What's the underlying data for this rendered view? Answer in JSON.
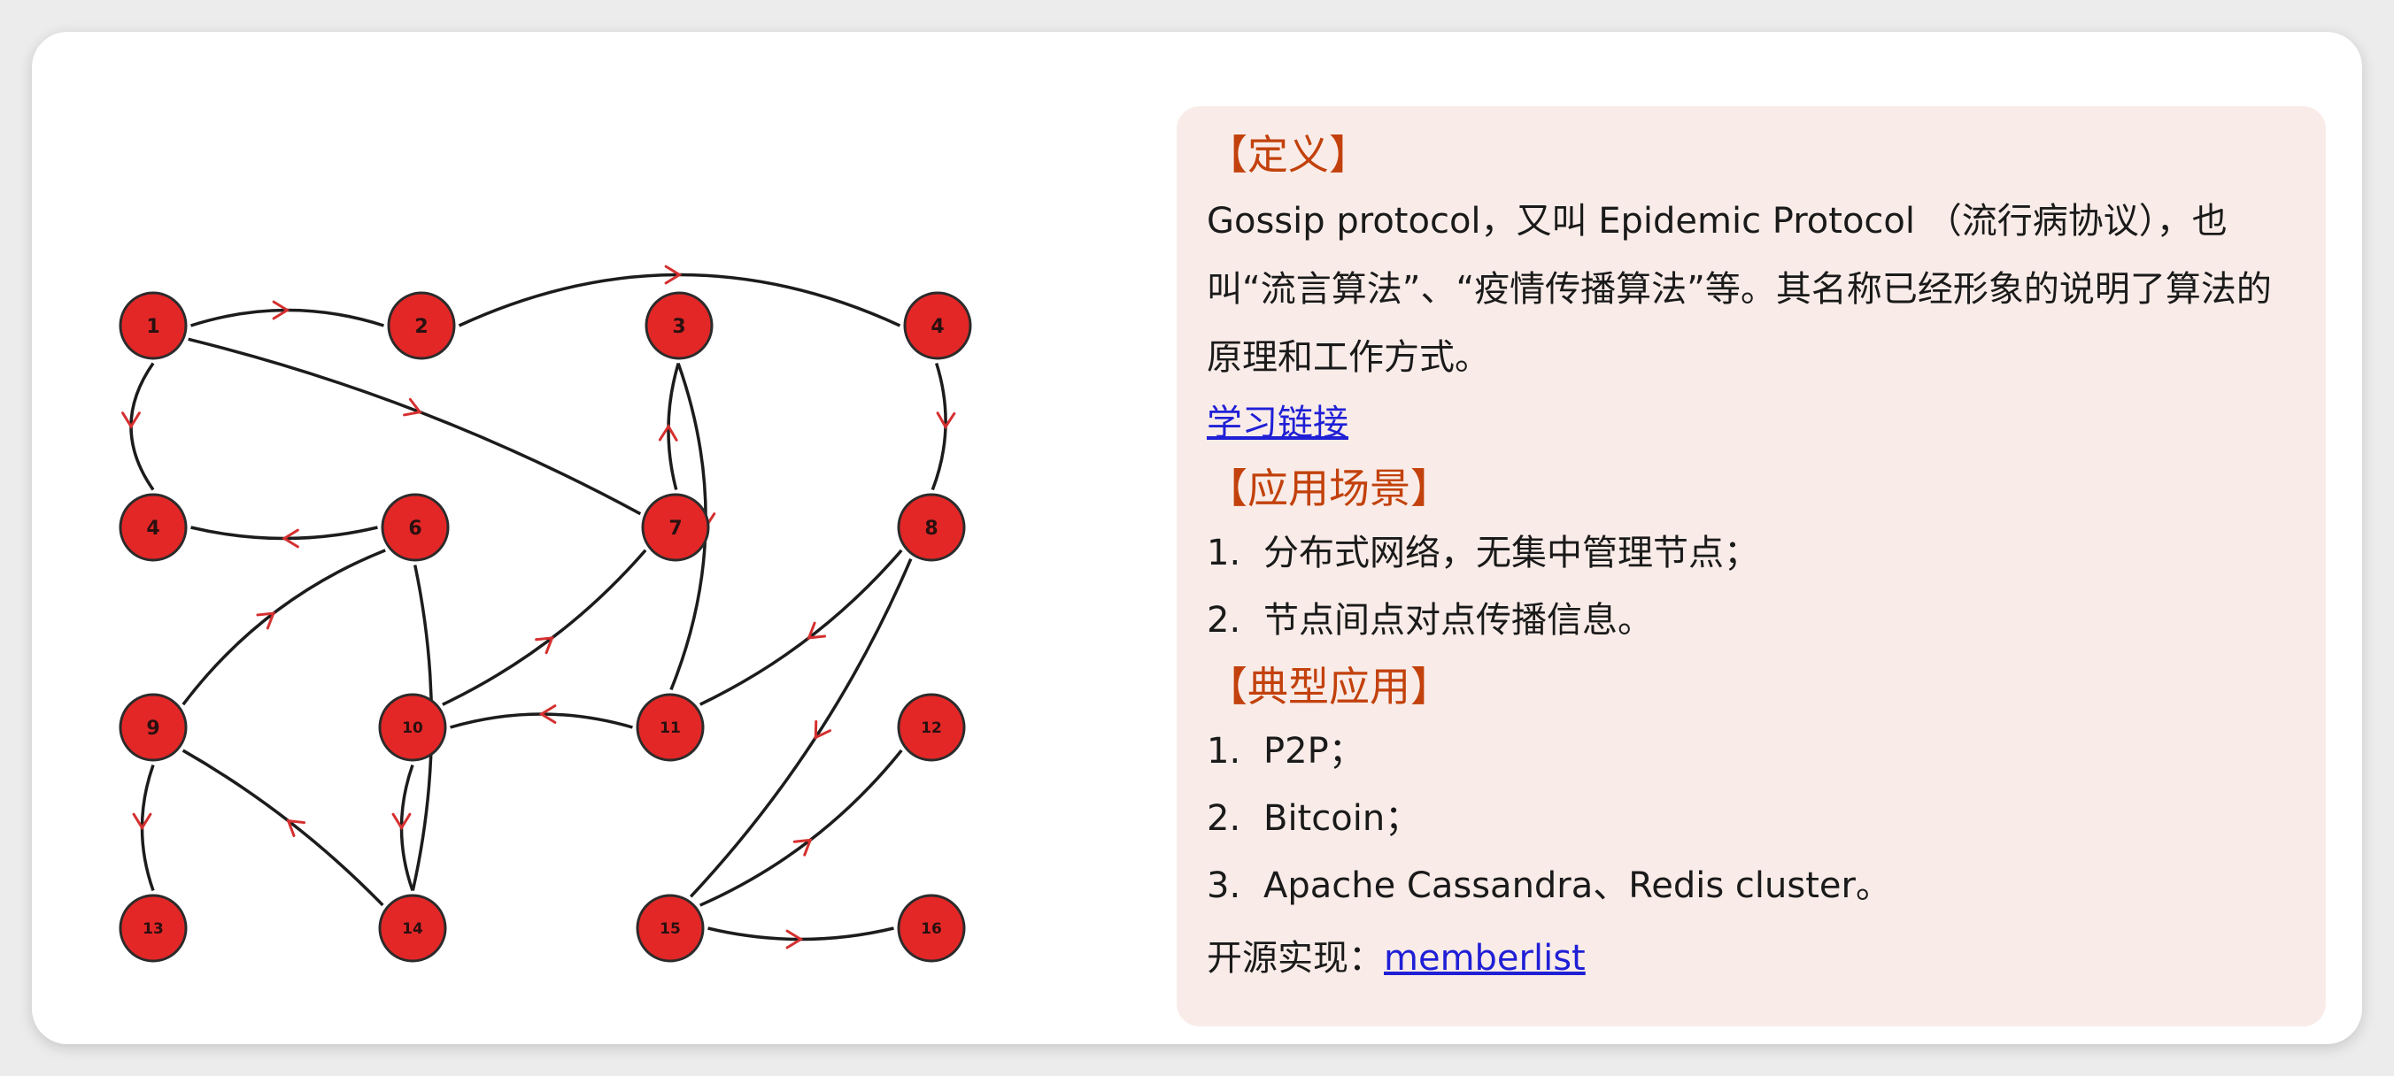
{
  "colors": {
    "node_fill": "#e32727",
    "node_stroke": "#2b2b2b",
    "edge": "#1c1c1c",
    "arrow": "#d52f2f",
    "heading": "#c2410c",
    "link": "#1f1fd6",
    "panel_bg": "#f9ece8"
  },
  "graph": {
    "nodes": [
      {
        "id": "1",
        "label": "1"
      },
      {
        "id": "2",
        "label": "2"
      },
      {
        "id": "3",
        "label": "3"
      },
      {
        "id": "4a",
        "label": "4"
      },
      {
        "id": "4b",
        "label": "4"
      },
      {
        "id": "6",
        "label": "6"
      },
      {
        "id": "7",
        "label": "7"
      },
      {
        "id": "8",
        "label": "8"
      },
      {
        "id": "9",
        "label": "9"
      },
      {
        "id": "10",
        "label": "10"
      },
      {
        "id": "11",
        "label": "11"
      },
      {
        "id": "12",
        "label": "12"
      },
      {
        "id": "13",
        "label": "13"
      },
      {
        "id": "14",
        "label": "14"
      },
      {
        "id": "15",
        "label": "15"
      },
      {
        "id": "16",
        "label": "16"
      }
    ],
    "edges": [
      {
        "from": "1",
        "to": "2"
      },
      {
        "from": "2",
        "to": "4a"
      },
      {
        "from": "1",
        "to": "7"
      },
      {
        "from": "1",
        "to": "4b"
      },
      {
        "from": "6",
        "to": "4b"
      },
      {
        "from": "7",
        "to": "3"
      },
      {
        "from": "3",
        "to": "11"
      },
      {
        "from": "4a",
        "to": "8"
      },
      {
        "from": "9",
        "to": "6"
      },
      {
        "from": "10",
        "to": "7"
      },
      {
        "from": "11",
        "to": "10"
      },
      {
        "from": "8",
        "to": "11"
      },
      {
        "from": "8",
        "to": "15"
      },
      {
        "from": "9",
        "to": "13"
      },
      {
        "from": "14",
        "to": "6"
      },
      {
        "from": "14",
        "to": "9"
      },
      {
        "from": "10",
        "to": "14"
      },
      {
        "from": "15",
        "to": "12"
      },
      {
        "from": "15",
        "to": "16"
      }
    ]
  },
  "panel": {
    "definition": {
      "heading": "【定义】",
      "text": "Gossip protocol，又叫 Epidemic Protocol （流行病协议），也叫“流言算法”、“疫情传播算法”等。其名称已经形象的说明了算法的原理和工作方式。",
      "link_text": "学习链接"
    },
    "scenarios": {
      "heading": "【应用场景】",
      "items": [
        {
          "num": "1.",
          "text": "分布式网络，无集中管理节点；"
        },
        {
          "num": "2.",
          "text": "节点间点对点传播信息。"
        }
      ]
    },
    "typical": {
      "heading": "【典型应用】",
      "items": [
        {
          "num": "1.",
          "text": "P2P；"
        },
        {
          "num": "2.",
          "text": "Bitcoin；"
        },
        {
          "num": "3.",
          "text": "Apache Cassandra、Redis cluster。"
        }
      ]
    },
    "footer": {
      "prefix": "开源实现：",
      "link_text": "memberlist"
    }
  }
}
